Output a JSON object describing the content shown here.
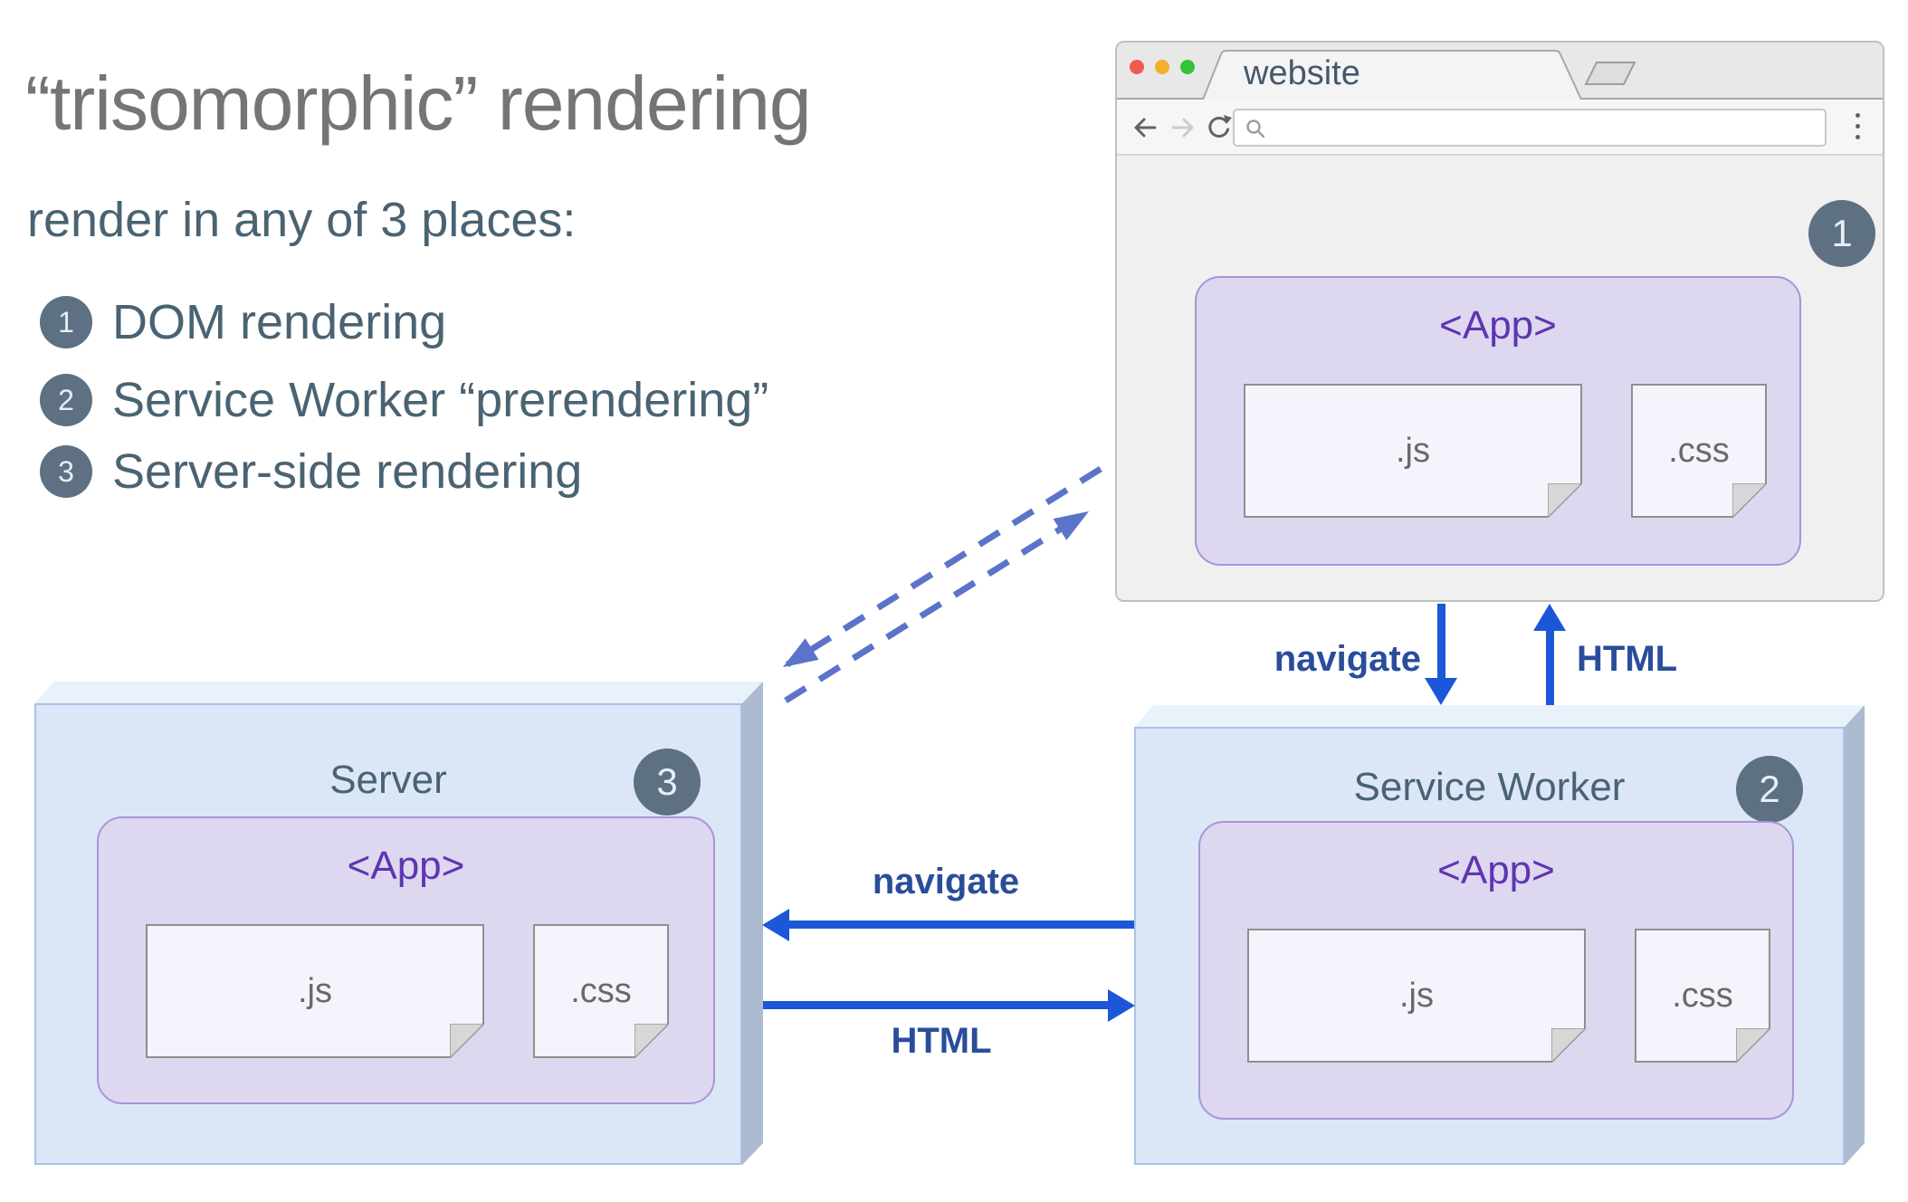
{
  "intro": {
    "title": "“trisomorphic” rendering",
    "subtitle": "render in any of 3 places:",
    "items": [
      {
        "num": "1",
        "label": "DOM rendering"
      },
      {
        "num": "2",
        "label": "Service Worker “prerendering”"
      },
      {
        "num": "3",
        "label": "Server-side rendering"
      }
    ]
  },
  "browser": {
    "tab_title": "website",
    "url_value": "",
    "badge": "1",
    "app": {
      "label": "<App>",
      "js": ".js",
      "css": ".css"
    }
  },
  "server": {
    "label": "Server",
    "badge": "3",
    "app": {
      "label": "<App>",
      "js": ".js",
      "css": ".css"
    }
  },
  "service_worker": {
    "label": "Service Worker",
    "badge": "2",
    "app": {
      "label": "<App>",
      "js": ".js",
      "css": ".css"
    }
  },
  "flows": {
    "browser_to_sw": "navigate",
    "sw_to_browser": "HTML",
    "sw_to_server": "navigate",
    "server_to_sw": "HTML"
  },
  "colors": {
    "arrow_blue": "#1b57d8",
    "flow_label_navy": "#2a4d9b",
    "dashed_periwinkle": "#5b74c9",
    "slate_text": "#4a6372",
    "title_gray": "#757575",
    "badge_slate": "#5d7183",
    "app_text_purple": "#5e35b1",
    "app_fill": "#ded7f0",
    "app_border": "#a894d8",
    "box_front": "#dbe7f7",
    "box_top": "#e9f1fb",
    "box_side": "#adbbd1",
    "traffic_red": "#f15a51",
    "traffic_yellow": "#f3b02c",
    "traffic_green": "#33c437"
  }
}
